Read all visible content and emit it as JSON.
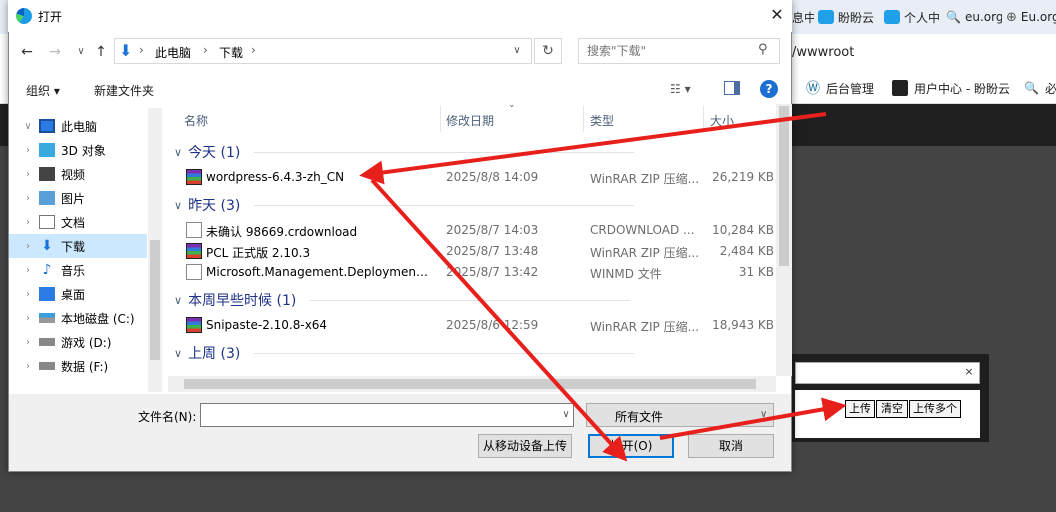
{
  "background": {
    "tabs": [
      "息中",
      "盼盼云",
      "个人中",
      "eu.org",
      "Eu.org"
    ],
    "address_fragment": "/wwwroot",
    "bookmarks": [
      "后台管理",
      "用户中心 - 盼盼云",
      "必"
    ]
  },
  "upload_popup": {
    "close": "×",
    "buttons": {
      "upload": "上传",
      "clear": "清空",
      "upload_multi": "上传多个"
    }
  },
  "dialog": {
    "title": "打开",
    "close": "✕",
    "nav": {
      "back": "←",
      "forward": "→",
      "dropdown": "∨",
      "up": "↑"
    },
    "breadcrumb": [
      "此电脑",
      "下载"
    ],
    "search_placeholder": "搜索\"下载\"",
    "toolbar": {
      "organize": "组织 ▾",
      "new_folder": "新建文件夹"
    },
    "tree": [
      {
        "label": "此电脑",
        "expander": "∨",
        "icon": "computer-icon"
      },
      {
        "label": "3D 对象",
        "expander": "›",
        "icon": "3d-objects-icon"
      },
      {
        "label": "视频",
        "expander": "›",
        "icon": "video-icon"
      },
      {
        "label": "图片",
        "expander": "›",
        "icon": "pictures-icon"
      },
      {
        "label": "文档",
        "expander": "›",
        "icon": "documents-icon"
      },
      {
        "label": "下载",
        "expander": "›",
        "icon": "downloads-icon",
        "selected": true
      },
      {
        "label": "音乐",
        "expander": "›",
        "icon": "music-icon"
      },
      {
        "label": "桌面",
        "expander": "›",
        "icon": "desktop-icon"
      },
      {
        "label": "本地磁盘 (C:)",
        "expander": "›",
        "icon": "drive-icon"
      },
      {
        "label": "游戏 (D:)",
        "expander": "›",
        "icon": "drive-icon"
      },
      {
        "label": "数据 (F:)",
        "expander": "›",
        "icon": "drive-icon"
      }
    ],
    "columns": {
      "name": "名称",
      "date": "修改日期",
      "type": "类型",
      "size": "大小"
    },
    "groups": [
      {
        "label": "今天 (1)",
        "files": [
          {
            "name": "wordpress-6.4.3-zh_CN",
            "date": "2025/8/8 14:09",
            "type": "WinRAR ZIP 压缩...",
            "size": "26,219 KB",
            "icon": "rar"
          }
        ]
      },
      {
        "label": "昨天 (3)",
        "files": [
          {
            "name": "未确认 98669.crdownload",
            "date": "2025/8/7 14:03",
            "type": "CRDOWNLOAD ...",
            "size": "10,284 KB",
            "icon": "doc"
          },
          {
            "name": "PCL 正式版 2.10.3",
            "date": "2025/8/7 13:48",
            "type": "WinRAR ZIP 压缩...",
            "size": "2,484 KB",
            "icon": "rar"
          },
          {
            "name": "Microsoft.Management.Deployment...",
            "date": "2025/8/7 13:42",
            "type": "WINMD 文件",
            "size": "31 KB",
            "icon": "doc"
          }
        ]
      },
      {
        "label": "本周早些时候 (1)",
        "files": [
          {
            "name": "Snipaste-2.10.8-x64",
            "date": "2025/8/6 12:59",
            "type": "WinRAR ZIP 压缩...",
            "size": "18,943 KB",
            "icon": "rar"
          }
        ]
      },
      {
        "label": "上周 (3)",
        "files": []
      }
    ],
    "filename_label": "文件名(N):",
    "filename_value": "",
    "filetype": "所有文件",
    "buttons": {
      "mobile_upload": "从移动设备上传",
      "open": "打开(O)",
      "cancel": "取消"
    }
  },
  "colors": {
    "annotation_arrow": "#e8201c",
    "accent": "#0078d7",
    "selection": "#cce8ff"
  }
}
